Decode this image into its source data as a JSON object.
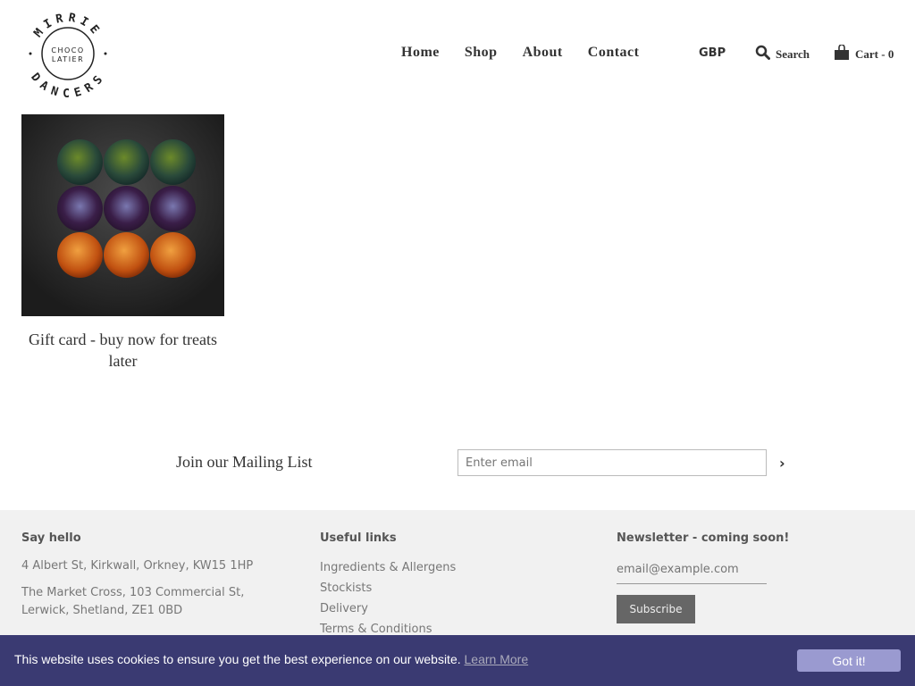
{
  "brand": {
    "logo_text": "MIRRIE DANCERS CHOCOLATIER"
  },
  "nav": {
    "items": [
      "Home",
      "Shop",
      "About",
      "Contact"
    ],
    "currency": "GBP",
    "search": "Search",
    "cart": "Cart - 0"
  },
  "product": {
    "title": "Gift card - buy now for treats later"
  },
  "mailing": {
    "label": "Join our Mailing List",
    "placeholder": "Enter email"
  },
  "footer": {
    "hello": {
      "heading": "Say hello",
      "address1": "4 Albert St, Kirkwall, Orkney, KW15 1HP",
      "address2": "The Market Cross, 103 Commercial St, Lerwick, Shetland, ZE1 0BD"
    },
    "links": {
      "heading": "Useful links",
      "items": [
        "Ingredients & Allergens",
        "Stockists",
        "Delivery",
        "Terms & Conditions"
      ]
    },
    "newsletter": {
      "heading": "Newsletter - coming soon!",
      "placeholder": "email@example.com",
      "button": "Subscribe"
    }
  },
  "cookie": {
    "message": "This website uses cookies to ensure you get the best experience on our website.",
    "link": "Learn More",
    "button": "Got it!"
  }
}
